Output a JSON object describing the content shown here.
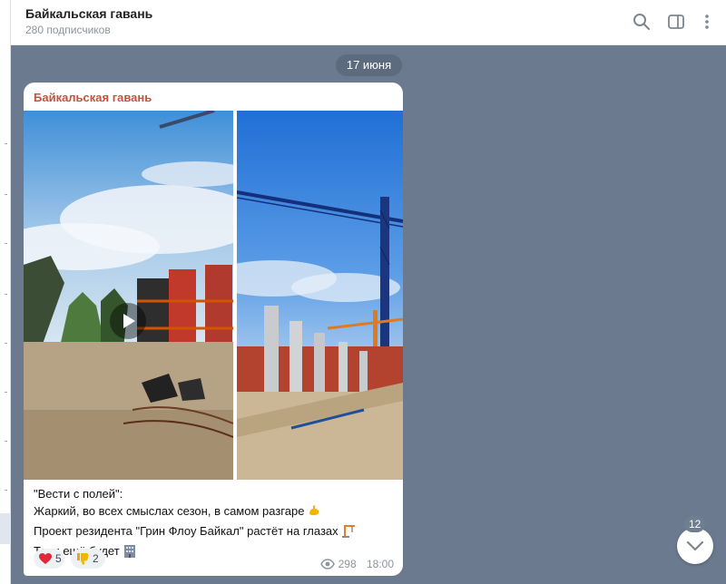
{
  "header": {
    "channel_name": "Байкальская гавань",
    "subscribers": "280 подписчиков",
    "icons": [
      "search-icon",
      "sidebar-toggle-icon",
      "more-vertical-icon"
    ]
  },
  "date_separator": "17 июня",
  "post": {
    "author": "Байкальская гавань",
    "media": [
      {
        "type": "video",
        "icon": "play-icon"
      },
      {
        "type": "photo"
      }
    ],
    "lines": [
      {
        "text": "\"Вести с полей\":",
        "emoji": ""
      },
      {
        "text": "Жаркий, во всех смыслах сезон, в самом разгаре",
        "emoji": "flexed-biceps-emoji"
      },
      {
        "text": "Проект резидента \"Грин Флоу Байкал\" растёт на глазах",
        "emoji": "construction-crane-emoji"
      },
      {
        "text": "Толи ещё будет",
        "emoji": "office-building-emoji"
      }
    ],
    "reactions": [
      {
        "icon": "heart-icon",
        "count": "5"
      },
      {
        "icon": "thumbs-down-icon",
        "count": "2"
      }
    ],
    "views": "298",
    "time": "18:00"
  },
  "scroll_button": {
    "unread_count": "12",
    "icon": "chevron-down-icon"
  },
  "colors": {
    "chat_background": "#6b7a8f",
    "author_name": "#c2533d",
    "date_pill": "#5d6b7f",
    "badge": "#6e7f91"
  }
}
